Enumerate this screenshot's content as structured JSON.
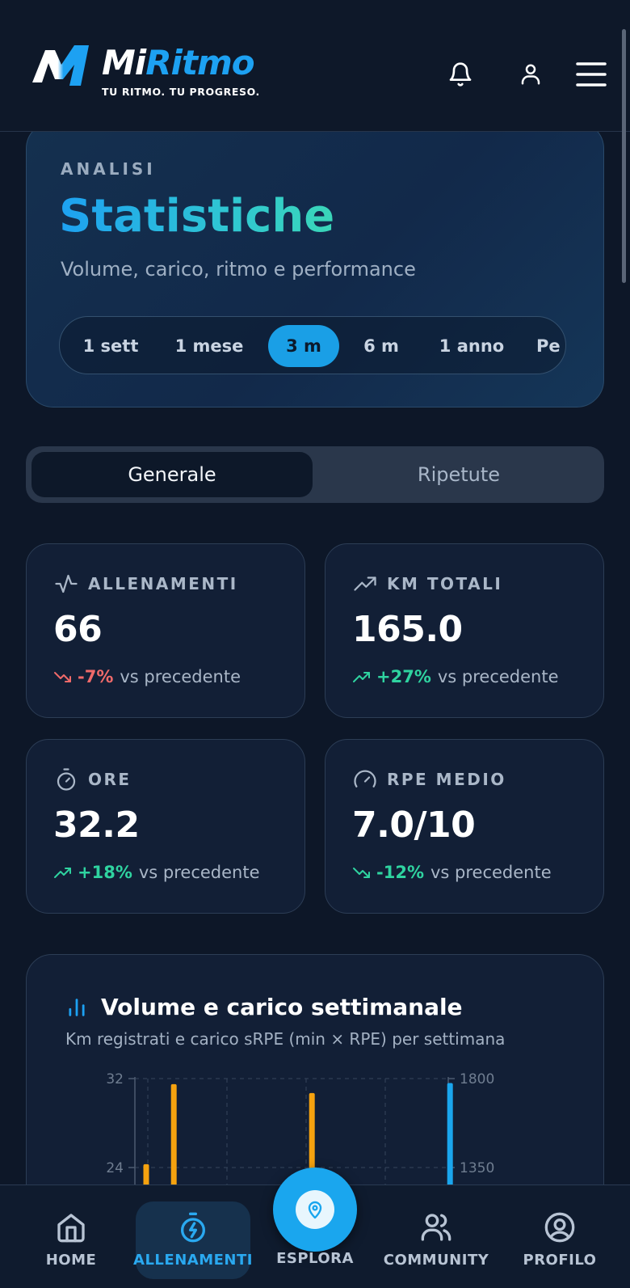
{
  "header": {
    "brand_mi": "Mi",
    "brand_ritmo": "Ritmo",
    "tagline": "TU RITMO. TU PROGRESO.",
    "icons": [
      "bell-icon",
      "user-icon",
      "menu-icon"
    ]
  },
  "hero": {
    "kicker": "ANALISI",
    "title": "Statistiche",
    "subtitle": "Volume, carico, ritmo e performance",
    "periods": [
      "1 sett",
      "1 mese",
      "3 m",
      "6 m",
      "1 anno",
      "Pe"
    ],
    "active_period": "3 m"
  },
  "segments": {
    "active": "Generale",
    "inactive": "Ripetute"
  },
  "stats": [
    {
      "label": "ALLENAMENTI",
      "value": "66",
      "delta": "-7%",
      "rest": "vs precedente",
      "trend": "down",
      "icon": "activity-icon"
    },
    {
      "label": "KM TOTALI",
      "value": "165.0",
      "delta": "+27%",
      "rest": "vs precedente",
      "trend": "up",
      "icon": "trending-up-icon"
    },
    {
      "label": "ORE",
      "value": "32.2",
      "delta": "+18%",
      "rest": "vs precedente",
      "trend": "up",
      "icon": "stopwatch-icon"
    },
    {
      "label": "RPE MEDIO",
      "value": "7.0/10",
      "delta": "-12%",
      "rest": "vs precedente",
      "trend": "down-good",
      "icon": "gauge-icon"
    }
  ],
  "chart_card": {
    "title": "Volume e carico settimanale",
    "subtitle": "Km registrati e carico sRPE (min × RPE) per settimana"
  },
  "chart_data": {
    "type": "bar",
    "y_left_ticks": [
      "32",
      "24"
    ],
    "y_right_ticks": [
      "1800",
      "1350"
    ],
    "ylim_left": [
      0,
      32
    ],
    "ylim_right": [
      0,
      1800
    ],
    "series": [
      {
        "color": "#f5a20f",
        "points": [
          {
            "slot": 1,
            "value": 24.3
          },
          {
            "slot": 2,
            "value": 31.5
          },
          {
            "slot": 7,
            "value": 30.7
          }
        ]
      },
      {
        "color": "#1aa6ee",
        "points": [
          {
            "slot": 12,
            "value": 31.6
          }
        ]
      }
    ],
    "grid": "dashed"
  },
  "nav": {
    "items": [
      "HOME",
      "ALLENAMENTI",
      "ESPLORA",
      "COMMUNITY",
      "PROFILO"
    ],
    "active": "ALLENAMENTI"
  },
  "colors": {
    "accent": "#1aa6ee",
    "positive": "#2fd3a0",
    "negative": "#f06a6a",
    "bar_orange": "#f5a20f"
  }
}
